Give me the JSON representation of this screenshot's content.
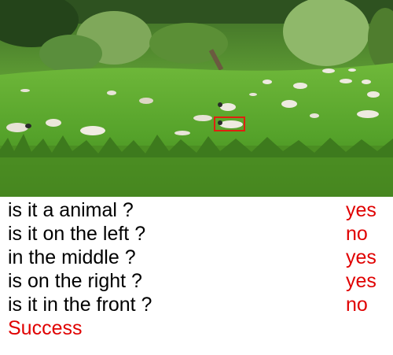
{
  "image": {
    "subject": "sheep",
    "highlight_color": "#e02010"
  },
  "dialog": {
    "rows": [
      {
        "question": "is it a animal ?",
        "answer": "yes"
      },
      {
        "question": "is it on the left ?",
        "answer": "no"
      },
      {
        "question": "in the middle ?",
        "answer": "yes"
      },
      {
        "question": "is on the right ?",
        "answer": "yes"
      },
      {
        "question": "is it in the front ?",
        "answer": "no"
      }
    ],
    "result": "Success",
    "answer_color": "#e00000",
    "question_color": "#000000"
  }
}
